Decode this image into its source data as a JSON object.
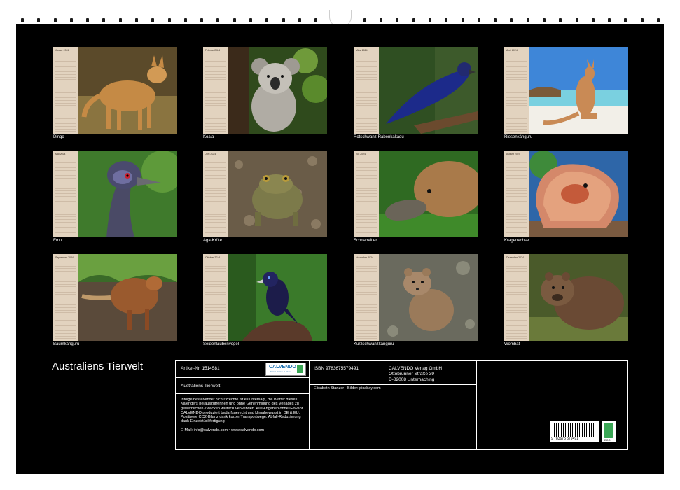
{
  "months": [
    {
      "month": "Januar 2024",
      "caption": "Dingo",
      "icon": "dingo-photo"
    },
    {
      "month": "Februar 2024",
      "caption": "Koala",
      "icon": "koala-photo"
    },
    {
      "month": "März 2024",
      "caption": "Rotschwanz-Rabenkakadu",
      "icon": "cockatoo-photo"
    },
    {
      "month": "April 2024",
      "caption": "Riesenkänguru",
      "icon": "kangaroo-photo"
    },
    {
      "month": "Mai 2024",
      "caption": "Emu",
      "icon": "emu-photo"
    },
    {
      "month": "Juni 2024",
      "caption": "Aga-Kröte",
      "icon": "toad-photo"
    },
    {
      "month": "Juli 2024",
      "caption": "Schnabeltier",
      "icon": "platypus-photo"
    },
    {
      "month": "August 2024",
      "caption": "Kragenechse",
      "icon": "frilled-lizard-photo"
    },
    {
      "month": "September 2024",
      "caption": "Baumkänguru",
      "icon": "tree-kangaroo-photo"
    },
    {
      "month": "Oktober 2024",
      "caption": "Seidenlaubenvogel",
      "icon": "bowerbird-photo"
    },
    {
      "month": "November 2024",
      "caption": "Kurzschwanzkänguru",
      "icon": "quokka-photo"
    },
    {
      "month": "Dezember 2024",
      "caption": "Wombat",
      "icon": "wombat-photo"
    }
  ],
  "title": "Australiens Tierwelt",
  "info": {
    "article": "Artikel-Nr. 1514581",
    "logo_name": "CALVENDO",
    "logo_sub": "Kunst · Natur · Leben",
    "product_title": "Australiens Tierwelt",
    "legal": "Infolge bestehender Schutzrechte ist es untersagt, die Blätter dieses Kalenders herauszutrennen und ohne Genehmigung des Verlages zu gewerblichen Zwecken weiterzuverwenden. Alle Angaben ohne Gewähr. CALVENDO produziert bedarfsgerecht und klimabewusst in DE & EU. Positivere CO2-Bilanz dank kurzer Transportwege. Abfall-Reduzierung dank Einzelstückfertigung.",
    "contact": "E-Mail: info@calvendo.com • www.calvendo.com",
    "isbn": "ISBN 9783675579491",
    "publisher_line1": "CALVENDO Verlag GmbH",
    "publisher_line2": "Ottobrunner Straße 39",
    "publisher_line3": "D-82008 Unterhaching",
    "credits": "Elisabeth Stanzer - Bilder: pixabay.com",
    "barcode_number": "9 783675 579491",
    "eco_label": "ECO"
  },
  "colors": {
    "background": "#000000",
    "calendar_strip": "#e2d3bf",
    "text": "#ffffff"
  }
}
